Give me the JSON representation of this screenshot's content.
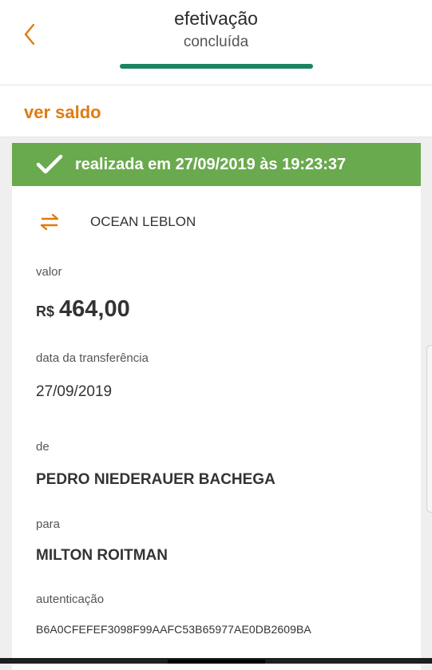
{
  "header": {
    "title_line1": "efetivação",
    "title_line2": "concluída",
    "progress_fraction": 1.0
  },
  "saldo": {
    "label": "ver saldo"
  },
  "status": {
    "text": "realizada em 27/09/2019 às 19:23:37",
    "icon": "check-icon"
  },
  "merchant": {
    "icon": "transfer-arrows-icon",
    "name": "OCEAN LEBLON"
  },
  "valor": {
    "label": "valor",
    "currency": "R$",
    "amount": "464,00"
  },
  "data_transferencia": {
    "label": "data da transferência",
    "value": "27/09/2019"
  },
  "de": {
    "label": "de",
    "value": "PEDRO NIEDERAUER BACHEGA"
  },
  "para": {
    "label": "para",
    "value": "MILTON ROITMAN"
  },
  "autenticacao": {
    "label": "autenticação",
    "value": "B6A0CFEFEF3098F99AAFC53B65977AE0DB2609BA"
  },
  "colors": {
    "accent_orange": "#e07b12",
    "success_green": "#6aaa4e",
    "progress_green": "#1c8363"
  }
}
